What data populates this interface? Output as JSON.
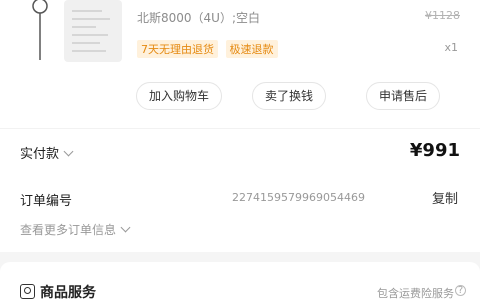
{
  "product": {
    "spec": "北斯8000（4U）;空白",
    "original_price": "¥1128",
    "tags": [
      "7天无理由退货",
      "极速退款"
    ],
    "quantity": "x1"
  },
  "actions": {
    "add_cart": "加入购物车",
    "resell": "卖了换钱",
    "after_sales": "申请售后"
  },
  "payment": {
    "label": "实付款",
    "amount": "¥991"
  },
  "order": {
    "number_label": "订单编号",
    "number": "2274159579969054469",
    "copy_label": "复制",
    "more_info": "查看更多订单信息"
  },
  "service": {
    "title": "商品服务",
    "description": "包含运费险服务"
  }
}
